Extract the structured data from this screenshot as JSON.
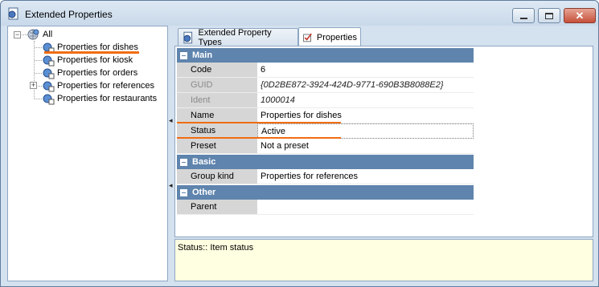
{
  "window": {
    "title": "Extended Properties"
  },
  "tree": {
    "root_label": "All",
    "items": [
      {
        "label": "Properties for dishes",
        "expandable": false
      },
      {
        "label": "Properties for kiosk",
        "expandable": false
      },
      {
        "label": "Properties for orders",
        "expandable": false
      },
      {
        "label": "Properties for references",
        "expandable": true
      },
      {
        "label": "Properties for restaurants",
        "expandable": false
      }
    ]
  },
  "tabs": [
    {
      "label": "Extended Property Types",
      "icon": "property-types-icon",
      "active": false
    },
    {
      "label": "Properties",
      "icon": "properties-icon",
      "active": true
    }
  ],
  "grid": {
    "main": {
      "title": "Main",
      "rows": [
        {
          "name": "Code",
          "value": "6"
        },
        {
          "name": "GUID",
          "value": "{0D2BE872-3924-424D-9771-690B3B8088E2}"
        },
        {
          "name": "Ident",
          "value": "1000014"
        },
        {
          "name": "Name",
          "value": "Properties for dishes"
        },
        {
          "name": "Status",
          "value": "Active"
        },
        {
          "name": "Preset",
          "value": "Not a preset"
        }
      ]
    },
    "basic": {
      "title": "Basic",
      "rows": [
        {
          "name": "Group kind",
          "value": "Properties for references"
        }
      ]
    },
    "other": {
      "title": "Other",
      "rows": [
        {
          "name": "Parent",
          "value": ""
        }
      ]
    }
  },
  "description": "Status:: Item status",
  "colors": {
    "category_bar": "#5f84ad",
    "highlight_underline": "#f06d12",
    "description_bg": "#ffffe1"
  }
}
